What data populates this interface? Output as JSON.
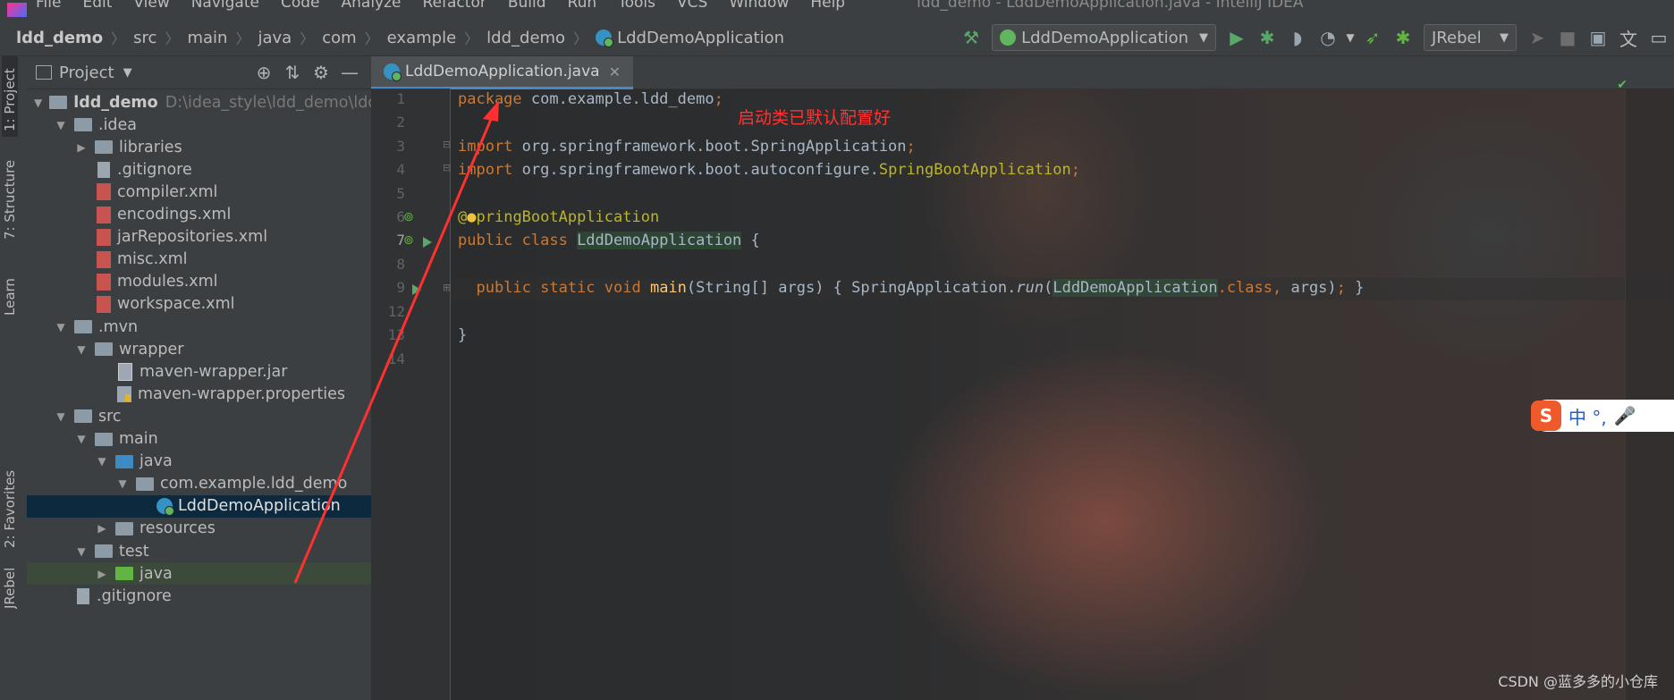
{
  "menubar": {
    "items": [
      "File",
      "Edit",
      "View",
      "Navigate",
      "Code",
      "Analyze",
      "Refactor",
      "Build",
      "Run",
      "Tools",
      "VCS",
      "Window",
      "Help"
    ],
    "window_title": "ldd_demo - LddDemoApplication.java - IntelliJ IDEA"
  },
  "breadcrumb": [
    "ldd_demo",
    "src",
    "main",
    "java",
    "com",
    "example",
    "ldd_demo",
    "LddDemoApplication"
  ],
  "toolbar": {
    "run_config": "LddDemoApplication",
    "jrebel": "JRebel"
  },
  "left_strip": {
    "project": "1: Project",
    "structure": "7: Structure",
    "learn": "Learn",
    "favorites": "2: Favorites",
    "jrebel": "JRebel"
  },
  "project_panel": {
    "title": "Project",
    "root_path": "D:\\idea_style\\ldd_demo\\ldd_dem",
    "tree": [
      {
        "label": "ldd_demo",
        "depth": 0,
        "kind": "module",
        "open": true
      },
      {
        "label": ".idea",
        "depth": 1,
        "kind": "folder",
        "open": true
      },
      {
        "label": "libraries",
        "depth": 2,
        "kind": "folder",
        "open": false
      },
      {
        "label": ".gitignore",
        "depth": 2,
        "kind": "txt"
      },
      {
        "label": "compiler.xml",
        "depth": 2,
        "kind": "xml"
      },
      {
        "label": "encodings.xml",
        "depth": 2,
        "kind": "xml"
      },
      {
        "label": "jarRepositories.xml",
        "depth": 2,
        "kind": "xml"
      },
      {
        "label": "misc.xml",
        "depth": 2,
        "kind": "xml"
      },
      {
        "label": "modules.xml",
        "depth": 2,
        "kind": "xml"
      },
      {
        "label": "workspace.xml",
        "depth": 2,
        "kind": "xml"
      },
      {
        "label": ".mvn",
        "depth": 1,
        "kind": "folder",
        "open": true
      },
      {
        "label": "wrapper",
        "depth": 2,
        "kind": "folder",
        "open": true
      },
      {
        "label": "maven-wrapper.jar",
        "depth": 3,
        "kind": "jar"
      },
      {
        "label": "maven-wrapper.properties",
        "depth": 3,
        "kind": "props"
      },
      {
        "label": "src",
        "depth": 1,
        "kind": "folder",
        "open": true
      },
      {
        "label": "main",
        "depth": 2,
        "kind": "folder",
        "open": true
      },
      {
        "label": "java",
        "depth": 3,
        "kind": "src",
        "open": true
      },
      {
        "label": "com.example.ldd_demo",
        "depth": 4,
        "kind": "pkg",
        "open": true
      },
      {
        "label": "LddDemoApplication",
        "depth": 5,
        "kind": "class",
        "selected": true
      },
      {
        "label": "resources",
        "depth": 3,
        "kind": "res",
        "open": false
      },
      {
        "label": "test",
        "depth": 2,
        "kind": "folder",
        "open": true
      },
      {
        "label": "java",
        "depth": 3,
        "kind": "test",
        "open": false,
        "highlight": true
      },
      {
        "label": ".gitignore",
        "depth": 1,
        "kind": "txt"
      }
    ]
  },
  "editor": {
    "tab_label": "LddDemoApplication.java",
    "annotation_note": "启动类已默认配置好",
    "line_numbers": [
      "1",
      "2",
      "3",
      "4",
      "5",
      "6",
      "7",
      "8",
      "9",
      "12",
      "13",
      "14"
    ]
  },
  "ime": {
    "label": "中 °,"
  },
  "watermark": "CSDN @蓝多多的小仓库",
  "colors": {
    "keyword": "#cc7832",
    "annotation": "#bbb529",
    "method": "#ffc66d",
    "note": "#ff3333",
    "selection": "#0d293e"
  }
}
